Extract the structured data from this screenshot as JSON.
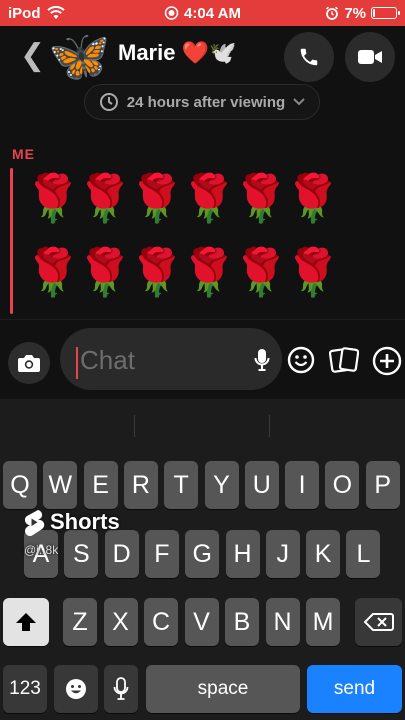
{
  "status_bar": {
    "carrier": "iPod",
    "time": "4:04 AM",
    "battery": "7%",
    "battery_level": 0.07,
    "color": "#e43b3b"
  },
  "header": {
    "contact_name": "Marie",
    "avatar_emoji": "🦋",
    "name_emoji": "❤️🕊️"
  },
  "chat": {
    "timer_text": "24 hours after viewing",
    "sender_label": "ME",
    "sender_color": "#e8434f",
    "message_emojis": [
      "🌹",
      "🌹",
      "🌹",
      "🌹",
      "🌹",
      "🌹",
      "🌹",
      "🌹",
      "🌹",
      "🌹",
      "🌹",
      "🌹"
    ]
  },
  "composer": {
    "placeholder": "Chat"
  },
  "keyboard": {
    "row1": [
      "Q",
      "W",
      "E",
      "R",
      "T",
      "Y",
      "U",
      "I",
      "O",
      "P"
    ],
    "row2": [
      "A",
      "S",
      "D",
      "F",
      "G",
      "H",
      "J",
      "K",
      "L"
    ],
    "row3": [
      "Z",
      "X",
      "C",
      "V",
      "B",
      "N",
      "M"
    ],
    "numbers_label": "123",
    "space_label": "space",
    "send_label": "send",
    "send_color": "#1a82ff"
  },
  "watermark": {
    "brand": "Shorts",
    "handle": "@i..8k"
  }
}
